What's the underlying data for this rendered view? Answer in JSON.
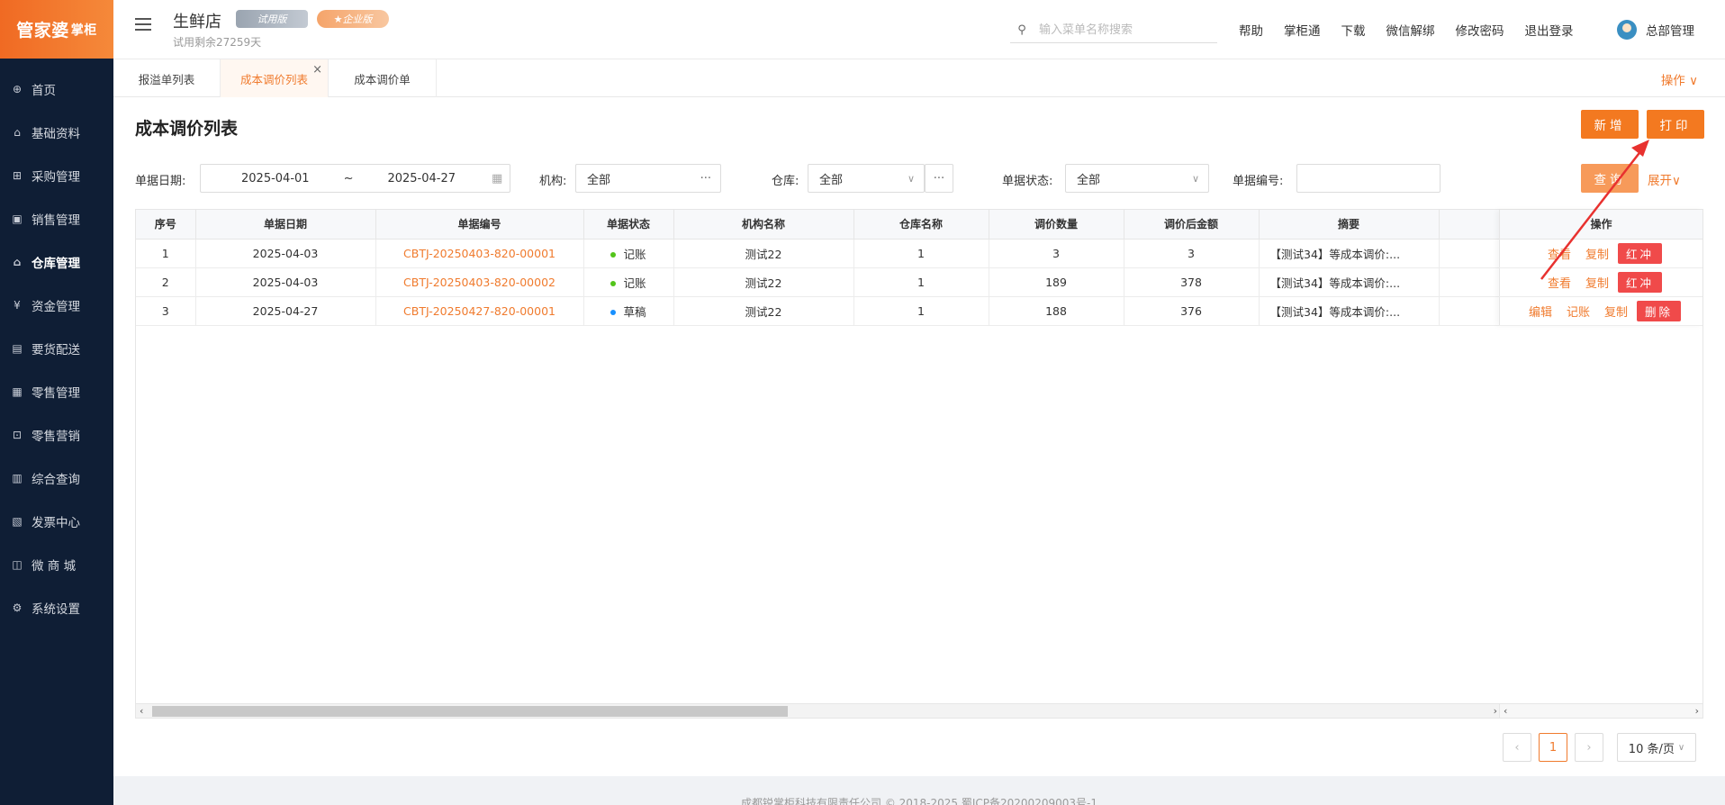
{
  "logo": {
    "main": "管家婆",
    "sub": "掌柜"
  },
  "sidebar": {
    "items": [
      {
        "label": "首页",
        "icon": "globe-icon",
        "glyph": "⊕"
      },
      {
        "label": "基础资料",
        "icon": "home-icon",
        "glyph": "⌂"
      },
      {
        "label": "采购管理",
        "icon": "cart-icon",
        "glyph": "⊞"
      },
      {
        "label": "销售管理",
        "icon": "sales-icon",
        "glyph": "▣"
      },
      {
        "label": "仓库管理",
        "icon": "warehouse-icon",
        "glyph": "⌂"
      },
      {
        "label": "资金管理",
        "icon": "money-icon",
        "glyph": "¥"
      },
      {
        "label": "要货配送",
        "icon": "delivery-icon",
        "glyph": "▤"
      },
      {
        "label": "零售管理",
        "icon": "retail-icon",
        "glyph": "▦"
      },
      {
        "label": "零售营销",
        "icon": "gift-icon",
        "glyph": "⊡"
      },
      {
        "label": "综合查询",
        "icon": "query-icon",
        "glyph": "▥"
      },
      {
        "label": "发票中心",
        "icon": "invoice-icon",
        "glyph": "▧"
      },
      {
        "label": "微 商 城",
        "icon": "shop-icon",
        "glyph": "◫"
      },
      {
        "label": "系统设置",
        "icon": "settings-icon",
        "glyph": "⚙"
      }
    ]
  },
  "header": {
    "store": "生鲜店",
    "trial_remaining": "试用剩余27259天",
    "badge_trial": "试用版",
    "badge_enterprise": "企业版",
    "search_placeholder": "输入菜单名称搜索",
    "links": [
      "帮助",
      "掌柜通",
      "下载",
      "微信解绑",
      "修改密码",
      "退出登录"
    ],
    "user": "总部管理"
  },
  "tabs": [
    {
      "label": "报溢单列表"
    },
    {
      "label": "成本调价列表",
      "close": "×"
    },
    {
      "label": "成本调价单"
    }
  ],
  "operations_label": "操作 ∨",
  "page": {
    "title": "成本调价列表",
    "add_label": "新增",
    "print_label": "打印",
    "query_label": "查询",
    "expand_label": "展开∨"
  },
  "filters": {
    "date_label": "单据日期:",
    "date_from": "2025-04-01",
    "date_sep": "~",
    "date_to": "2025-04-27",
    "org_label": "机构:",
    "org_value": "全部",
    "warehouse_label": "仓库:",
    "warehouse_value": "全部",
    "status_label": "单据状态:",
    "status_value": "全部",
    "code_label": "单据编号:",
    "code_value": ""
  },
  "table": {
    "headers": [
      "序号",
      "单据日期",
      "单据编号",
      "单据状态",
      "机构名称",
      "仓库名称",
      "调价数量",
      "调价后金额",
      "摘要",
      "",
      "操作"
    ],
    "rows": [
      {
        "no": "1",
        "date": "2025-04-03",
        "code": "CBTJ-20250403-820-00001",
        "status": "记账",
        "status_color": "#52c41a",
        "org": "测试22",
        "warehouse": "1",
        "qty": "3",
        "amount": "3",
        "summary": "【测试34】等成本调价:...",
        "ops": [
          "查看",
          "复制"
        ],
        "danger": "红冲"
      },
      {
        "no": "2",
        "date": "2025-04-03",
        "code": "CBTJ-20250403-820-00002",
        "status": "记账",
        "status_color": "#52c41a",
        "org": "测试22",
        "warehouse": "1",
        "qty": "189",
        "amount": "378",
        "summary": "【测试34】等成本调价:...",
        "ops": [
          "查看",
          "复制"
        ],
        "danger": "红冲"
      },
      {
        "no": "3",
        "date": "2025-04-27",
        "code": "CBTJ-20250427-820-00001",
        "status": "草稿",
        "status_color": "#1890ff",
        "org": "测试22",
        "warehouse": "1",
        "qty": "188",
        "amount": "376",
        "summary": "【测试34】等成本调价:...",
        "ops": [
          "编辑",
          "记账",
          "复制"
        ],
        "danger": "删除"
      }
    ]
  },
  "pagination": {
    "current": "1",
    "page_size": "10 条/页"
  },
  "footer": "成都锐掌柜科技有限责任公司 © 2018-2025 蜀ICP备20200209003号-1",
  "colors": {
    "accent": "#f37920",
    "sidebar": "#0f1e35",
    "danger": "#f04a4a"
  }
}
